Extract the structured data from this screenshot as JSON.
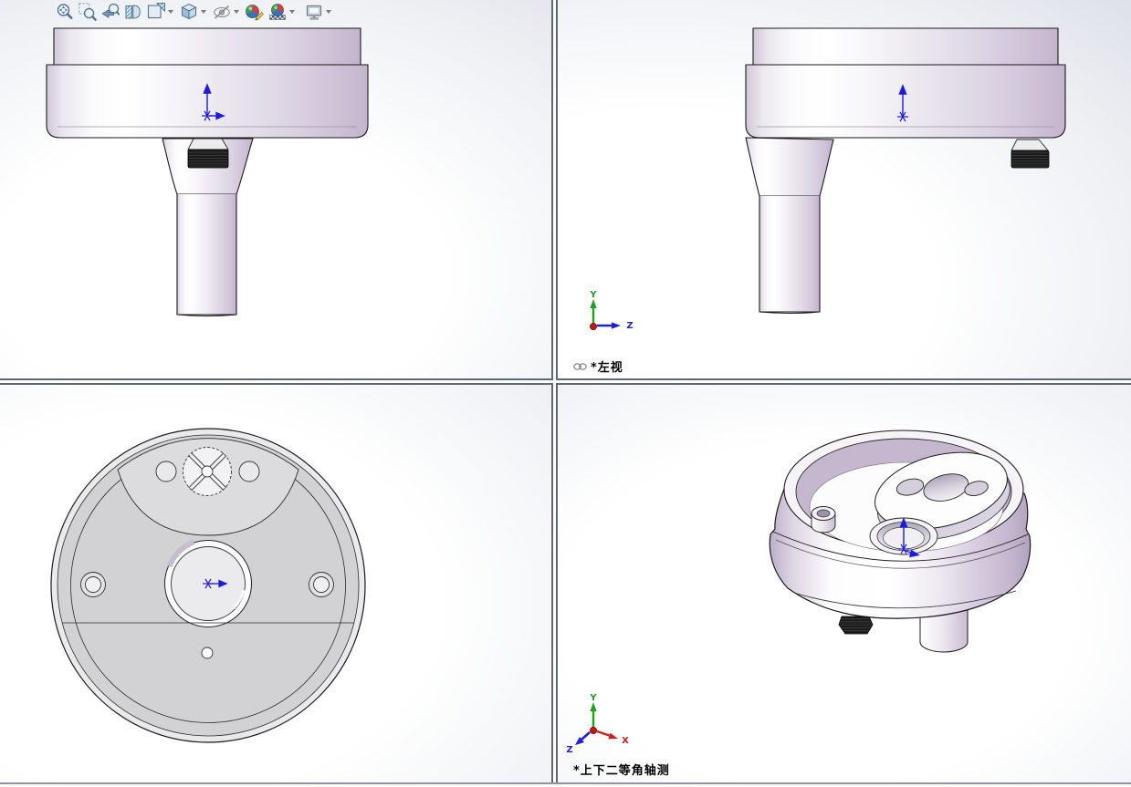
{
  "toolbar": {
    "buttons": [
      {
        "name": "zoom-to-fit",
        "dropdown": false
      },
      {
        "name": "zoom-to-area",
        "dropdown": false
      },
      {
        "name": "previous-view",
        "dropdown": false
      },
      {
        "name": "section-view",
        "dropdown": false
      },
      {
        "name": "view-orientation",
        "dropdown": true
      },
      {
        "name": "display-style",
        "dropdown": true
      },
      {
        "name": "hide-show-items",
        "dropdown": true
      },
      {
        "name": "edit-appearance",
        "dropdown": false
      },
      {
        "name": "apply-scene",
        "dropdown": true
      },
      {
        "name": "view-settings",
        "dropdown": true
      }
    ]
  },
  "viewports": {
    "top_right": {
      "label": "*左视",
      "linked": true,
      "triad": {
        "y": "Y",
        "z": "Z"
      }
    },
    "bottom_right": {
      "label": "*上下二等角轴测",
      "triad": {
        "x": "X",
        "y": "Y",
        "z": "Z"
      }
    }
  },
  "colors": {
    "origin_marker": "#1a1ae0",
    "axis_x": "#cc2020",
    "axis_y": "#1fa11f",
    "axis_z": "#2020cc",
    "part_highlight": "#ffffff",
    "part_shadow": "#c9bcd2",
    "outline": "#1a1a1a",
    "background_corner": "#d6dae4",
    "divider": "#5f6674"
  }
}
